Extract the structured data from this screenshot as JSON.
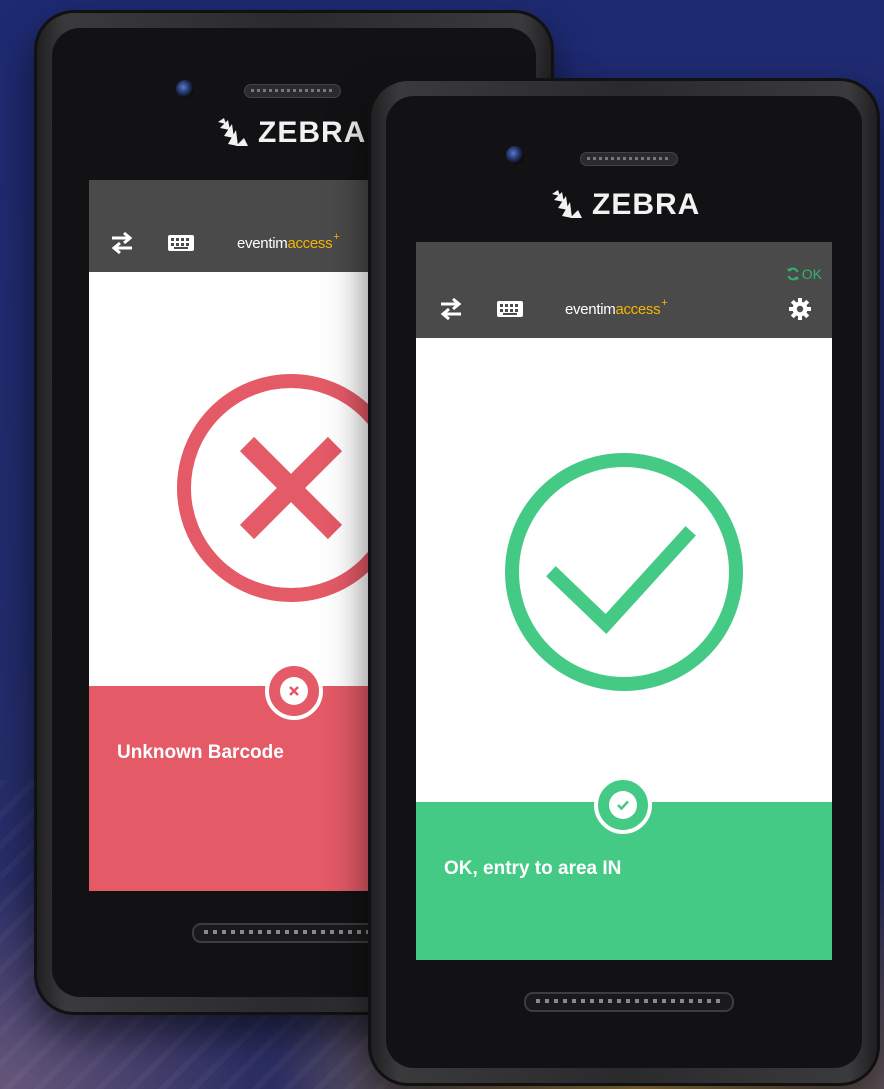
{
  "colors": {
    "error": "#e45a67",
    "success": "#45ca86",
    "appbar": "#4a4a4a",
    "brand_accent": "#f6b500",
    "status_ok": "#36b36a"
  },
  "devices": {
    "left": {
      "brand": "ZEBRA",
      "app": {
        "logo_prefix": "eventim",
        "logo_accent": "access",
        "logo_plus": "+",
        "swap_icon": "swap-arrows-icon",
        "keyboard_icon": "keyboard-icon"
      },
      "result": {
        "state": "error",
        "big_icon": "x-circle-icon",
        "badge_icon": "close-icon",
        "message": "Unknown Barcode"
      }
    },
    "right": {
      "brand": "ZEBRA",
      "app": {
        "status_text": "OK",
        "status_icon": "sync-icon",
        "logo_prefix": "eventim",
        "logo_accent": "access",
        "logo_plus": "+",
        "swap_icon": "swap-arrows-icon",
        "keyboard_icon": "keyboard-icon",
        "settings_icon": "gear-icon"
      },
      "result": {
        "state": "success",
        "big_icon": "check-circle-icon",
        "badge_icon": "check-icon",
        "message": "OK, entry to area IN"
      }
    }
  }
}
